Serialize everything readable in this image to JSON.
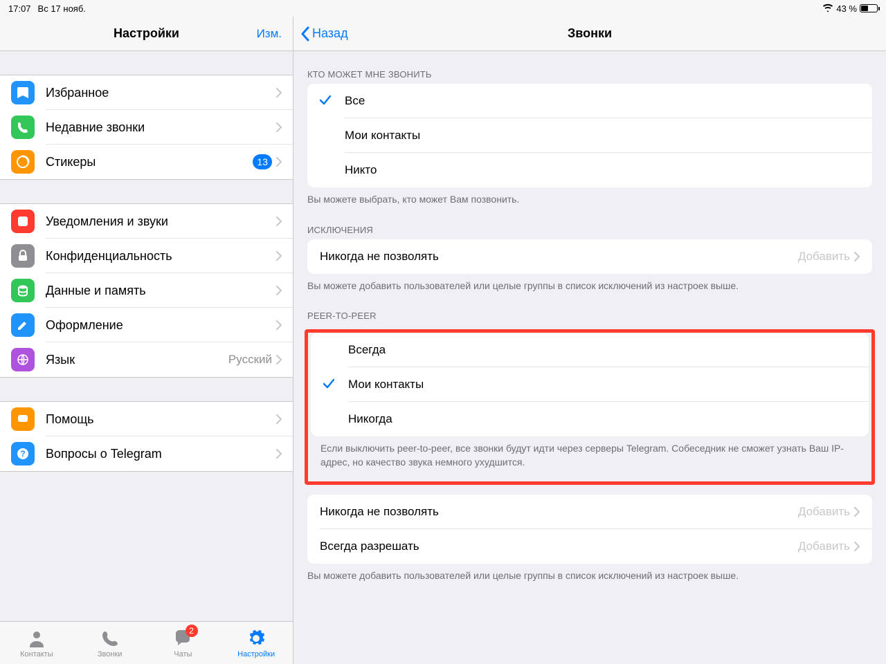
{
  "status": {
    "time": "17:07",
    "date": "Вс 17 нояб.",
    "battery": "43 %"
  },
  "sidebar": {
    "title": "Настройки",
    "edit": "Изм.",
    "g1": [
      {
        "label": "Избранное",
        "icon_bg": "#2094fa"
      },
      {
        "label": "Недавние звонки",
        "icon_bg": "#33c759"
      },
      {
        "label": "Стикеры",
        "icon_bg": "#ff9500",
        "badge": "13"
      }
    ],
    "g2": [
      {
        "label": "Уведомления и звуки",
        "icon_bg": "#ff3b30"
      },
      {
        "label": "Конфиденциальность",
        "icon_bg": "#8e8e93"
      },
      {
        "label": "Данные и память",
        "icon_bg": "#33c759"
      },
      {
        "label": "Оформление",
        "icon_bg": "#2094fa"
      },
      {
        "label": "Язык",
        "icon_bg": "#af52de",
        "value": "Русский"
      }
    ],
    "g3": [
      {
        "label": "Помощь",
        "icon_bg": "#ff9500"
      },
      {
        "label": "Вопросы о Telegram",
        "icon_bg": "#2094fa"
      }
    ]
  },
  "tabs": {
    "contacts": "Контакты",
    "calls": "Звонки",
    "chats": "Чаты",
    "chats_badge": "2",
    "settings": "Настройки"
  },
  "main": {
    "back": "Назад",
    "title": "Звонки",
    "s1_header": "КТО МОЖЕТ МНЕ ЗВОНИТЬ",
    "s1_opts": [
      "Все",
      "Мои контакты",
      "Никто"
    ],
    "s1_selected": 0,
    "s1_footer": "Вы можете выбрать, кто может Вам позвонить.",
    "s2_header": "ИСКЛЮЧЕНИЯ",
    "s2_row_label": "Никогда не позволять",
    "s2_row_value": "Добавить",
    "s2_footer": "Вы можете добавить пользователей или целые группы в список исключений из настроек выше.",
    "s3_header": "PEER-TO-PEER",
    "s3_opts": [
      "Всегда",
      "Мои контакты",
      "Никогда"
    ],
    "s3_selected": 1,
    "s3_footer": "Если выключить peer-to-peer, все звонки будут идти через серверы Telegram. Собеседник не сможет узнать Ваш IP-адрес, но качество звука немного ухудшится.",
    "s4_r1_label": "Никогда не позволять",
    "s4_r1_value": "Добавить",
    "s4_r2_label": "Всегда разрешать",
    "s4_r2_value": "Добавить",
    "s4_footer": "Вы можете добавить пользователей или целые группы в список исключений из настроек выше."
  }
}
